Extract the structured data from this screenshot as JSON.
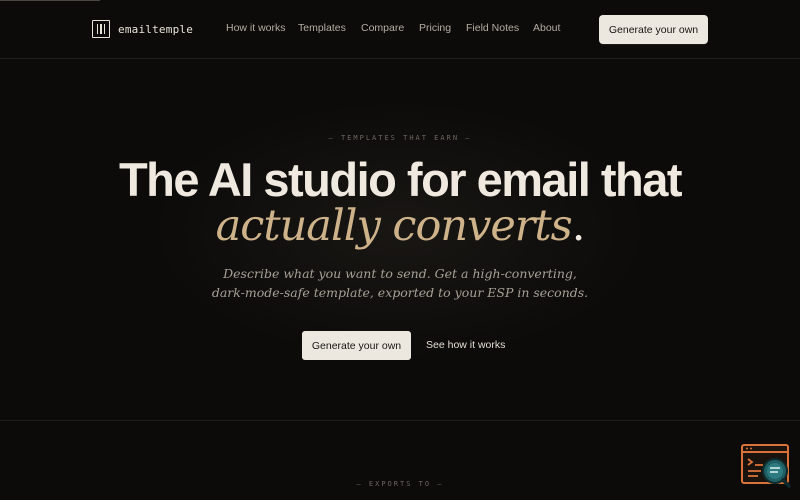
{
  "brand": {
    "name": "emailtemple"
  },
  "nav": {
    "items": [
      "How it works",
      "Templates",
      "Compare",
      "Pricing",
      "Field Notes",
      "About"
    ],
    "cta_label": "Generate your own"
  },
  "hero": {
    "eyebrow": "— TEMPLATES THAT EARN —",
    "headline_line1": "The AI studio for email that",
    "headline_accent": "actually converts",
    "headline_period": ".",
    "subhead_line1": "Describe what you want to send. Get a high-converting,",
    "subhead_line2": "dark-mode-safe template, exported to your ESP in seconds.",
    "primary_cta": "Generate your own",
    "secondary_cta": "See how it works"
  },
  "exports": {
    "label": "— EXPORTS TO —"
  },
  "widget": {
    "icon": "code-window-search-icon"
  },
  "colors": {
    "background": "#0c0b0a",
    "text": "#efe9df",
    "accent": "#cdb28a",
    "button_bg": "#ede8df",
    "widget_orange": "#d9733a",
    "widget_teal": "#1f5f63"
  }
}
